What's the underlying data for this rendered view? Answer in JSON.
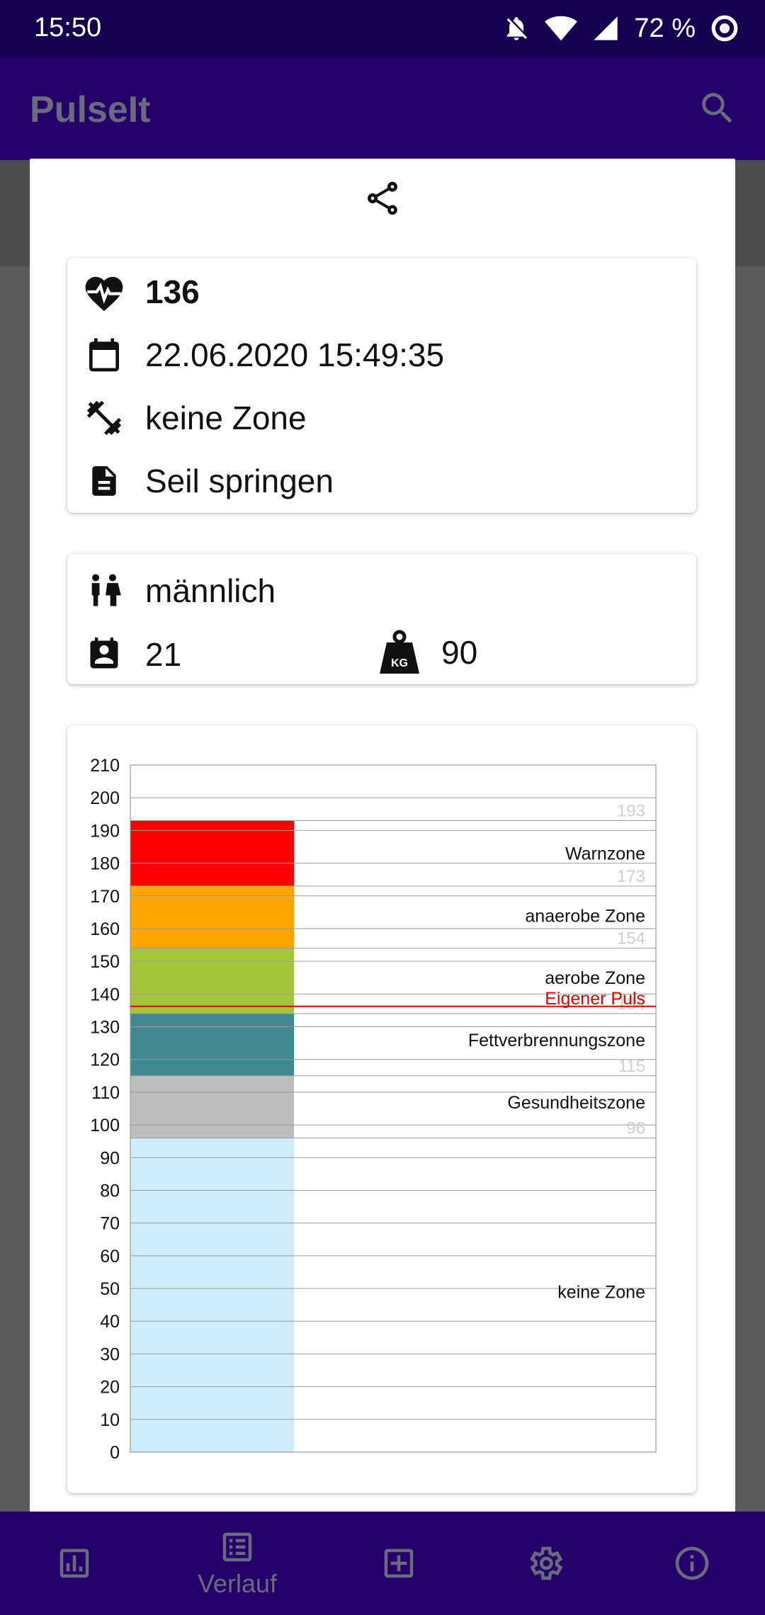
{
  "status_bar": {
    "time": "15:50",
    "battery": "72 %",
    "icons": [
      "mute-icon",
      "wifi-icon",
      "signal-icon",
      "battery-saver-icon"
    ]
  },
  "app_bar": {
    "title": "PulseIt",
    "search_icon": "search-icon"
  },
  "dialog": {
    "share_icon": "share-icon",
    "measurement": {
      "pulse": "136",
      "datetime": "22.06.2020 15:49:35",
      "zone": "keine Zone",
      "activity": "Seil springen"
    },
    "person": {
      "gender": "männlich",
      "age": "21",
      "weight": "90",
      "weight_icon_label": "KG"
    }
  },
  "colors": {
    "primary": "#24006b",
    "status": "#14004f",
    "warn": "#ff0000",
    "anaerob": "#ffa500",
    "aerob": "#a4c639",
    "fat": "#3f8a91",
    "health": "#bdbdbd",
    "none": "#cfeefb",
    "own_pulse": "#e00000"
  },
  "chart_data": {
    "type": "bar",
    "ylim": [
      0,
      210
    ],
    "y_ticks": [
      0,
      10,
      20,
      30,
      40,
      50,
      60,
      70,
      80,
      90,
      100,
      110,
      120,
      130,
      140,
      150,
      160,
      170,
      180,
      190,
      200,
      210
    ],
    "stacked_segments": [
      {
        "name": "keine Zone",
        "from": 0,
        "to": 96,
        "color": "#cfeefb"
      },
      {
        "name": "Gesundheitszone",
        "from": 96,
        "to": 115,
        "color": "#bdbdbd"
      },
      {
        "name": "Fettverbrennungszone",
        "from": 115,
        "to": 134,
        "color": "#3f8a91"
      },
      {
        "name": "aerobe Zone",
        "from": 134,
        "to": 154,
        "color": "#a4c639"
      },
      {
        "name": "anaerobe Zone",
        "from": 154,
        "to": 173,
        "color": "#ffa500"
      },
      {
        "name": "Warnzone",
        "from": 173,
        "to": 193,
        "color": "#ff0000"
      }
    ],
    "zone_labels": [
      {
        "text": "Warnzone",
        "y": 183
      },
      {
        "text": "anaerobe Zone",
        "y": 164
      },
      {
        "text": "aerobe Zone",
        "y": 145
      },
      {
        "text": "Fettverbrennungszone",
        "y": 126
      },
      {
        "text": "Gesundheitszone",
        "y": 107
      },
      {
        "text": "keine Zone",
        "y": 49
      }
    ],
    "limit_labels": [
      {
        "text": "193",
        "y": 193
      },
      {
        "text": "173",
        "y": 173
      },
      {
        "text": "154",
        "y": 154
      },
      {
        "text": "134",
        "y": 134
      },
      {
        "text": "115",
        "y": 115
      },
      {
        "text": "96",
        "y": 96
      }
    ],
    "own_pulse": {
      "label": "Eigener Puls",
      "value": 136
    }
  },
  "bottom_nav": {
    "items": [
      {
        "icon": "chart-icon",
        "label": ""
      },
      {
        "icon": "list-icon",
        "label": "Verlauf"
      },
      {
        "icon": "add-icon",
        "label": ""
      },
      {
        "icon": "settings-icon",
        "label": ""
      },
      {
        "icon": "info-icon",
        "label": ""
      }
    ]
  }
}
